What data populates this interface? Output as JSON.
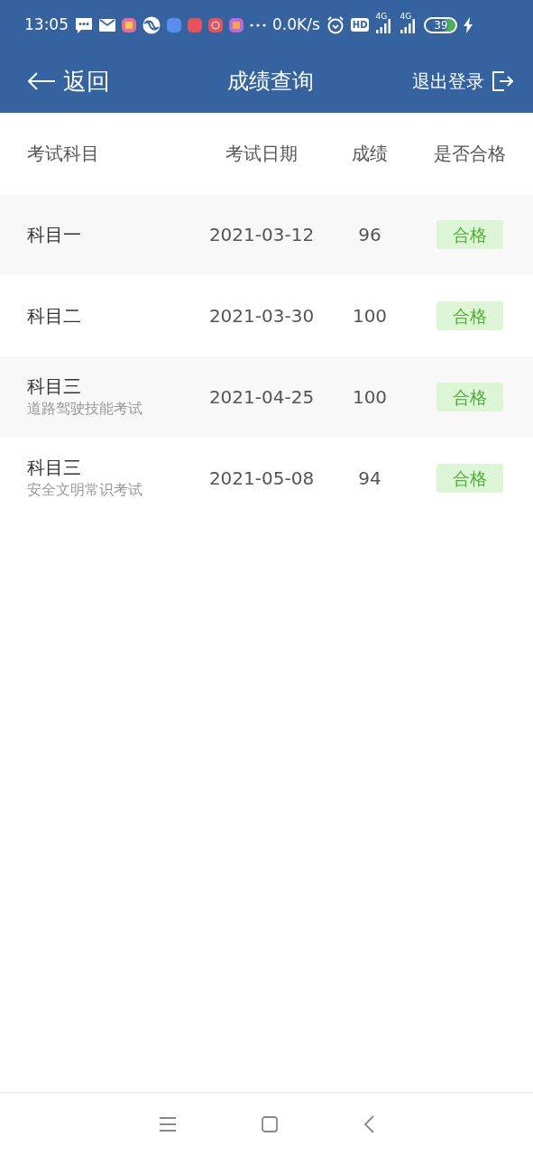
{
  "status_bar": {
    "time": "13:05",
    "net_speed": "0.0K/s",
    "hd": "HD",
    "sim_labels": [
      "4G",
      "4G"
    ],
    "battery": "39",
    "charging": true
  },
  "header": {
    "back": "返回",
    "title": "成绩查询",
    "logout": "退出登录"
  },
  "table": {
    "columns": [
      "考试科目",
      "考试日期",
      "成绩",
      "是否合格"
    ],
    "rows": [
      {
        "subject": "科目一",
        "date": "2021-03-12",
        "score": "96",
        "result": "合格",
        "passed": true
      },
      {
        "subject": "科目二",
        "date": "2021-03-30",
        "score": "100",
        "result": "合格",
        "passed": true
      },
      {
        "subject": "科目三",
        "subtitle": "道路驾驶技能考试",
        "date": "2021-04-25",
        "score": "100",
        "result": "合格",
        "passed": true
      },
      {
        "subject": "科目三",
        "subtitle": "安全文明常识考试",
        "date": "2021-05-08",
        "score": "94",
        "result": "合格",
        "passed": true
      }
    ]
  }
}
